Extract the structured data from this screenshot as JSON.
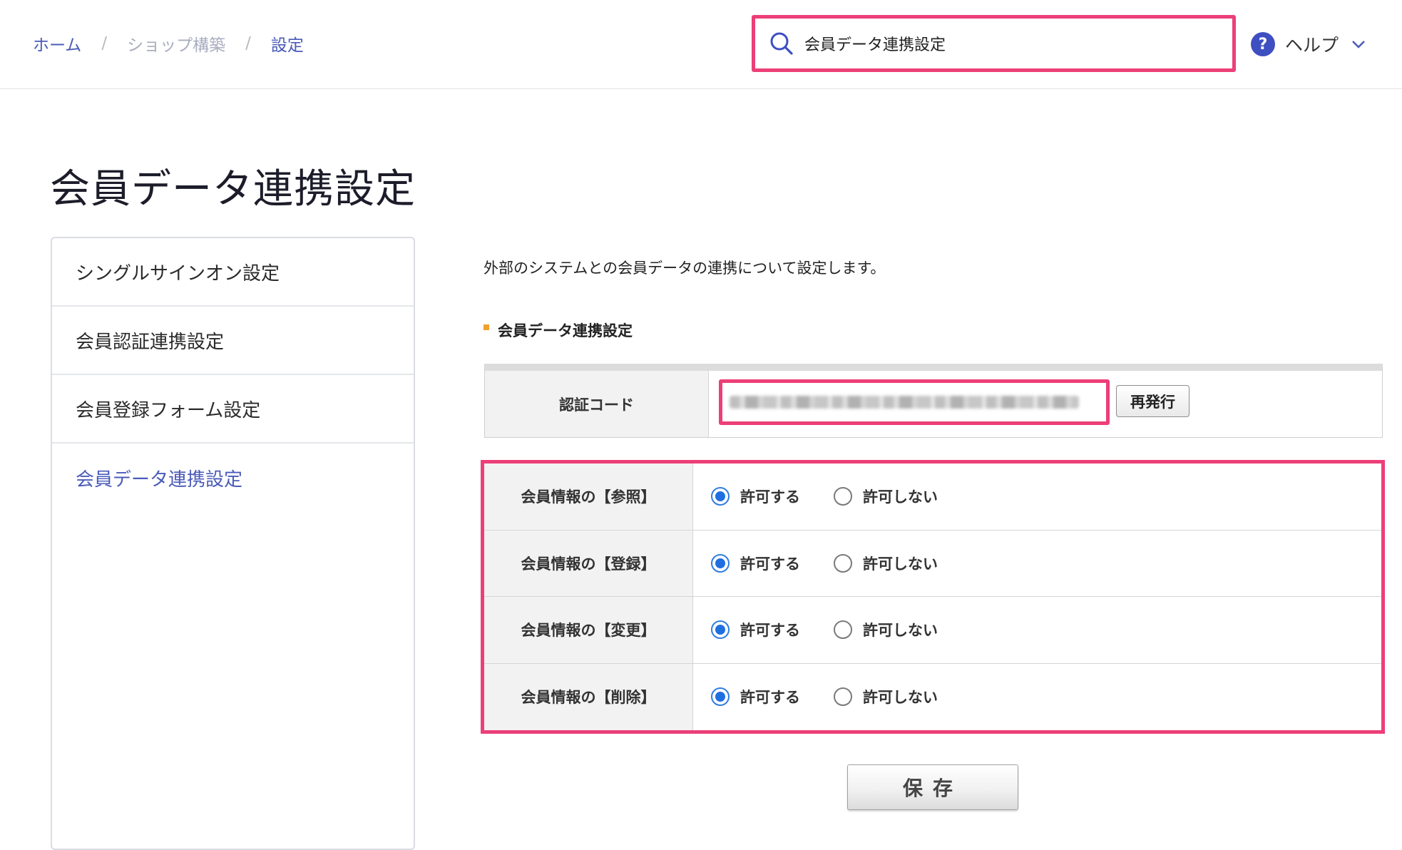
{
  "breadcrumb": {
    "home": "ホーム",
    "separator": "/",
    "shop": "ショップ構築",
    "current": "設定"
  },
  "search": {
    "value": "会員データ連携設定"
  },
  "help": {
    "label": "ヘルプ",
    "icon_glyph": "?"
  },
  "page": {
    "title": "会員データ連携設定"
  },
  "sidebar": {
    "items": [
      {
        "label": "シングルサインオン設定"
      },
      {
        "label": "会員認証連携設定"
      },
      {
        "label": "会員登録フォーム設定"
      },
      {
        "label": "会員データ連携設定"
      }
    ]
  },
  "main": {
    "description": "外部のシステムとの会員データの連携について設定します。",
    "section_heading": "会員データ連携設定",
    "auth": {
      "label": "認証コード",
      "reissue_label": "再発行"
    },
    "permissions": [
      {
        "label": "会員情報の【参照】",
        "allow": "許可する",
        "deny": "許可しない",
        "selected": "allow"
      },
      {
        "label": "会員情報の【登録】",
        "allow": "許可する",
        "deny": "許可しない",
        "selected": "allow"
      },
      {
        "label": "会員情報の【変更】",
        "allow": "許可する",
        "deny": "許可しない",
        "selected": "allow"
      },
      {
        "label": "会員情報の【削除】",
        "allow": "許可する",
        "deny": "許可しない",
        "selected": "allow"
      }
    ],
    "save_label": "保存"
  },
  "colors": {
    "highlight": "#ec3f78",
    "link": "#4a5bb8",
    "radio_checked": "#1f6fe0",
    "section_bullet": "#f0a030"
  }
}
